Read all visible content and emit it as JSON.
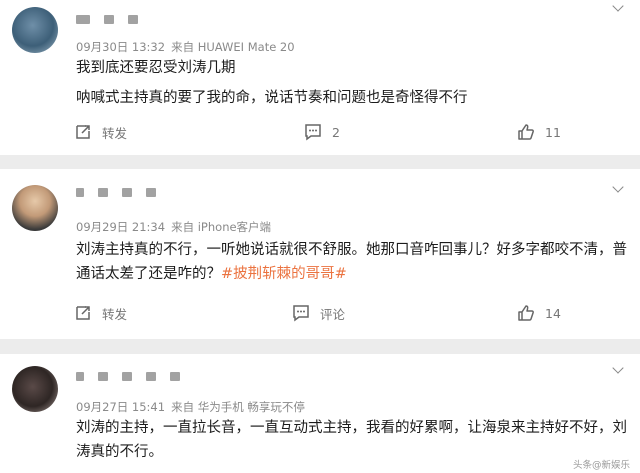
{
  "comments": [
    {
      "meta": {
        "date": "09月30日 13:32",
        "source": "来自 HUAWEI Mate 20"
      },
      "lines": [
        "我到底还要忍受刘涛几期",
        "呐喊式主持真的要了我的命，说话节奏和问题也是奇怪得不行"
      ],
      "actions": {
        "repost": "转发",
        "comment": "2",
        "like": "11"
      }
    },
    {
      "meta": {
        "date": "09月29日 21:34",
        "source": "来自 iPhone客户端"
      },
      "text_plain": "刘涛主持真的不行，一听她说话就很不舒服。她那口音咋回事儿？好多字都咬不清，普通话太差了还是咋的？",
      "topic": "#披荆斩棘的哥哥#",
      "actions": {
        "repost": "转发",
        "comment": "评论",
        "like": "14"
      }
    },
    {
      "meta": {
        "date": "09月27日 15:41",
        "source": "来自 华为手机 畅享玩不停"
      },
      "text_plain": "刘涛的主持，一直拉长音，一直互动式主持，我看的好累啊，让海泉来主持好不好，刘涛真的不行。"
    }
  ],
  "watermark": "头条@新娱乐"
}
